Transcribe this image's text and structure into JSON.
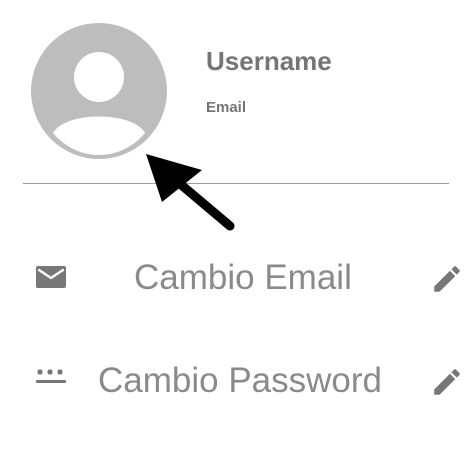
{
  "profile": {
    "avatar_icon": "account-circle-icon",
    "username": "Username",
    "email": "Email"
  },
  "annotation": {
    "icon": "arrow-pointer-icon"
  },
  "settings": {
    "items": [
      {
        "icon": "mail-icon",
        "label": "Cambio Email",
        "action_icon": "pencil-icon"
      },
      {
        "icon": "password-icon",
        "label": "Cambio Password",
        "action_icon": "pencil-icon"
      }
    ]
  },
  "colors": {
    "avatar": "#bdbdbd",
    "text": "#757575",
    "label": "#8a8a8a",
    "icon": "#777777",
    "divider": "#9e9e9e",
    "arrow": "#000000"
  }
}
